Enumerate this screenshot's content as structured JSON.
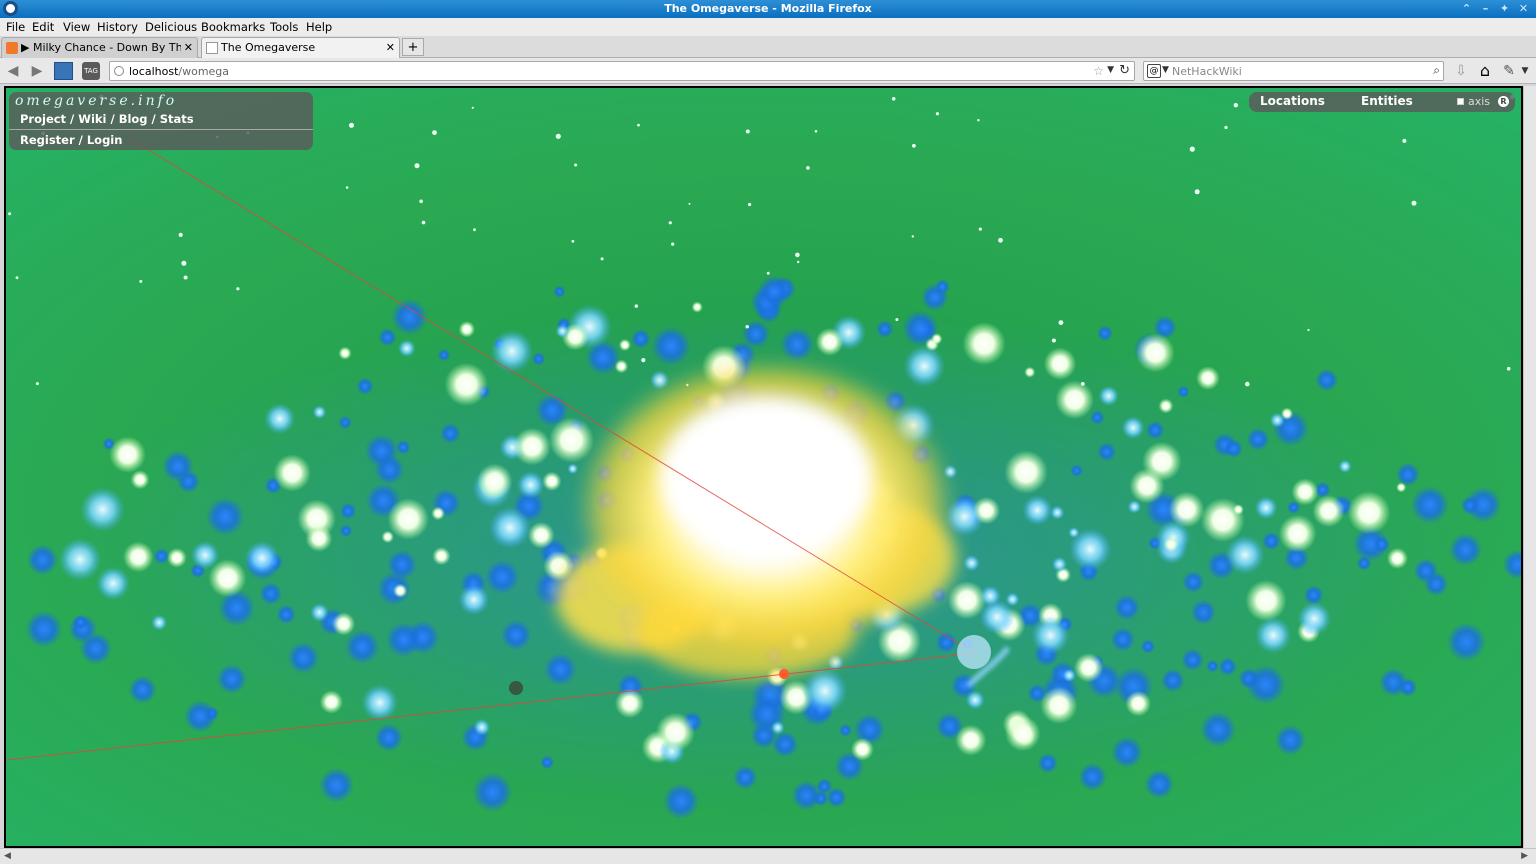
{
  "window": {
    "title": "The Omegaverse - Mozilla Firefox"
  },
  "menu": {
    "items": [
      "File",
      "Edit",
      "View",
      "History",
      "Delicious",
      "Bookmarks",
      "Tools",
      "Help"
    ]
  },
  "tabs": [
    {
      "label": "▶ Milky Chance - Down By The…",
      "active": false
    },
    {
      "label": "The Omegaverse",
      "active": true
    }
  ],
  "new_tab_label": "+",
  "navbar": {
    "url_host": "localhost",
    "url_path": "/womega",
    "search_engine_label": "NetHackWiki"
  },
  "site_panel": {
    "brand": "omegaverse.info",
    "links": "Project / Wiki / Blog / Stats",
    "auth": "Register / Login"
  },
  "right_panel": {
    "locations_label": "Locations",
    "entities_label": "Entities",
    "axis_label": "axis",
    "reset_label": "R"
  },
  "colors": {
    "background_green": "#2aa852",
    "star_blue": "#1f6fe0",
    "star_white": "#f4fff2",
    "core_yellow": "#ffe14a",
    "axis_red": "#e0463a"
  }
}
